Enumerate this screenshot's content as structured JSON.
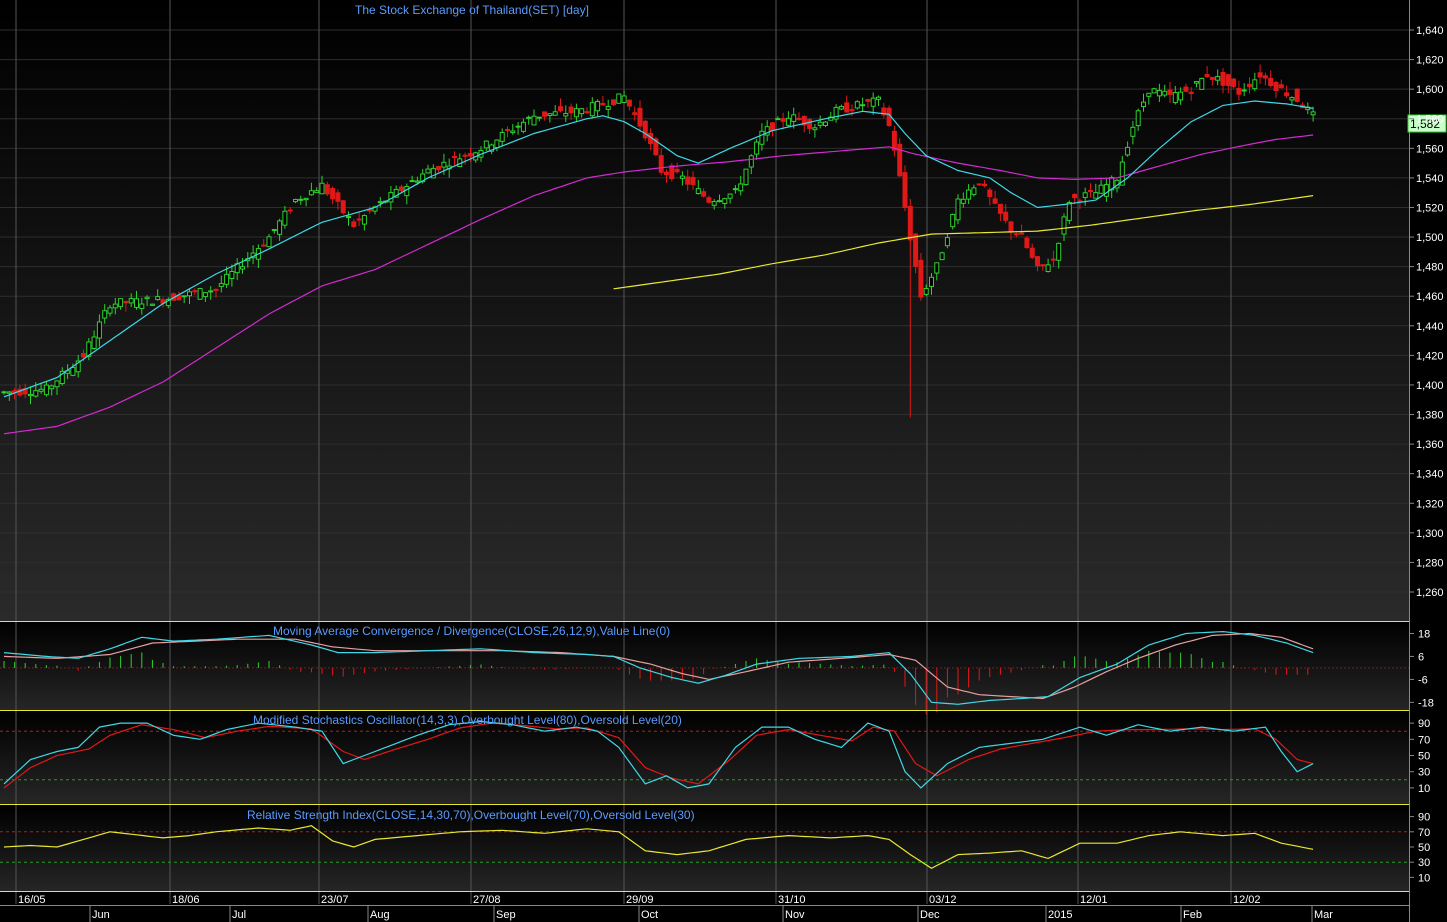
{
  "chart_data": {
    "type": "candlestick",
    "title": "The Stock Exchange of Thailand(SET) [day]",
    "last_price_label": "1,582",
    "colors": {
      "background": "#000000",
      "up_candle": "#2ed12e",
      "down_candle": "#e01818",
      "ma_short": "#3fd8e6",
      "ma_medium": "#d12bd1",
      "ma_long": "#e8e832",
      "panel_border": "#e8e832",
      "title_text": "#5a9bff",
      "axis_text": "#ffffff"
    },
    "price_panel": {
      "ylim": [
        1250,
        1650
      ],
      "ticks": [
        "1,260",
        "1,280",
        "1,300",
        "1,320",
        "1,340",
        "1,360",
        "1,380",
        "1,400",
        "1,420",
        "1,440",
        "1,460",
        "1,480",
        "1,500",
        "1,520",
        "1,540",
        "1,560",
        "1,580",
        "1,600",
        "1,620",
        "1,640"
      ],
      "close_keypoints": [
        [
          0,
          1395
        ],
        [
          8,
          1397
        ],
        [
          15,
          1420
        ],
        [
          20,
          1455
        ],
        [
          30,
          1458
        ],
        [
          40,
          1465
        ],
        [
          50,
          1500
        ],
        [
          55,
          1525
        ],
        [
          60,
          1535
        ],
        [
          66,
          1508
        ],
        [
          70,
          1520
        ],
        [
          80,
          1545
        ],
        [
          90,
          1560
        ],
        [
          100,
          1582
        ],
        [
          108,
          1585
        ],
        [
          113,
          1590
        ],
        [
          117,
          1595
        ],
        [
          121,
          1570
        ],
        [
          124,
          1545
        ],
        [
          128,
          1540
        ],
        [
          133,
          1525
        ],
        [
          138,
          1530
        ],
        [
          143,
          1570
        ],
        [
          148,
          1582
        ],
        [
          153,
          1575
        ],
        [
          157,
          1585
        ],
        [
          162,
          1590
        ],
        [
          165,
          1592
        ],
        [
          167,
          1575
        ],
        [
          168,
          1560
        ],
        [
          170,
          1520
        ],
        [
          173,
          1460
        ],
        [
          176,
          1480
        ],
        [
          180,
          1525
        ],
        [
          184,
          1538
        ],
        [
          187,
          1520
        ],
        [
          190,
          1505
        ],
        [
          192,
          1500
        ],
        [
          195,
          1478
        ],
        [
          198,
          1485
        ],
        [
          201,
          1525
        ],
        [
          206,
          1530
        ],
        [
          210,
          1540
        ],
        [
          213,
          1575
        ],
        [
          216,
          1600
        ],
        [
          220,
          1595
        ],
        [
          224,
          1600
        ],
        [
          227,
          1610
        ],
        [
          230,
          1605
        ],
        [
          233,
          1598
        ],
        [
          237,
          1610
        ],
        [
          240,
          1602
        ],
        [
          244,
          1593
        ],
        [
          247,
          1582
        ]
      ],
      "ma_short_keypoints": [
        [
          0,
          1392
        ],
        [
          10,
          1405
        ],
        [
          20,
          1430
        ],
        [
          30,
          1455
        ],
        [
          40,
          1475
        ],
        [
          50,
          1492
        ],
        [
          60,
          1510
        ],
        [
          65,
          1515
        ],
        [
          70,
          1520
        ],
        [
          80,
          1540
        ],
        [
          90,
          1556
        ],
        [
          100,
          1570
        ],
        [
          110,
          1580
        ],
        [
          113,
          1582
        ],
        [
          117,
          1578
        ],
        [
          121,
          1570
        ],
        [
          127,
          1555
        ],
        [
          131,
          1550
        ],
        [
          137,
          1560
        ],
        [
          145,
          1572
        ],
        [
          155,
          1580
        ],
        [
          162,
          1585
        ],
        [
          167,
          1583
        ],
        [
          170,
          1570
        ],
        [
          174,
          1555
        ],
        [
          180,
          1545
        ],
        [
          186,
          1540
        ],
        [
          190,
          1530
        ],
        [
          195,
          1520
        ],
        [
          200,
          1522
        ],
        [
          206,
          1525
        ],
        [
          212,
          1540
        ],
        [
          218,
          1560
        ],
        [
          224,
          1578
        ],
        [
          230,
          1589
        ],
        [
          236,
          1592
        ],
        [
          242,
          1590
        ],
        [
          247,
          1587
        ]
      ],
      "ma_medium_keypoints": [
        [
          0,
          1367
        ],
        [
          10,
          1372
        ],
        [
          20,
          1385
        ],
        [
          30,
          1402
        ],
        [
          40,
          1425
        ],
        [
          50,
          1448
        ],
        [
          60,
          1467
        ],
        [
          70,
          1478
        ],
        [
          80,
          1495
        ],
        [
          90,
          1512
        ],
        [
          100,
          1528
        ],
        [
          110,
          1540
        ],
        [
          117,
          1544
        ],
        [
          127,
          1548
        ],
        [
          137,
          1551
        ],
        [
          147,
          1555
        ],
        [
          157,
          1558
        ],
        [
          167,
          1561
        ],
        [
          172,
          1556
        ],
        [
          180,
          1550
        ],
        [
          188,
          1545
        ],
        [
          195,
          1540
        ],
        [
          202,
          1539
        ],
        [
          210,
          1540
        ],
        [
          218,
          1548
        ],
        [
          226,
          1556
        ],
        [
          234,
          1562
        ],
        [
          240,
          1566
        ],
        [
          247,
          1569
        ]
      ],
      "ma_long_keypoints": [
        [
          115,
          1465
        ],
        [
          125,
          1470
        ],
        [
          135,
          1475
        ],
        [
          145,
          1482
        ],
        [
          155,
          1488
        ],
        [
          165,
          1496
        ],
        [
          175,
          1502
        ],
        [
          185,
          1503
        ],
        [
          195,
          1504
        ],
        [
          205,
          1508
        ],
        [
          215,
          1513
        ],
        [
          225,
          1518
        ],
        [
          235,
          1522
        ],
        [
          247,
          1528
        ]
      ]
    },
    "macd_panel": {
      "title": "Moving Average Convergence / Divergence(CLOSE,26,12,9),Value Line(0)",
      "ylim": [
        -22,
        24
      ],
      "ticks": [
        "18",
        "6",
        "-6",
        "-18"
      ],
      "macd_keypoints": [
        [
          0,
          8
        ],
        [
          8,
          6
        ],
        [
          14,
          5
        ],
        [
          20,
          10
        ],
        [
          26,
          16
        ],
        [
          32,
          14
        ],
        [
          40,
          15
        ],
        [
          50,
          17
        ],
        [
          58,
          12
        ],
        [
          63,
          8
        ],
        [
          70,
          8
        ],
        [
          80,
          9
        ],
        [
          90,
          10
        ],
        [
          100,
          8
        ],
        [
          110,
          7
        ],
        [
          115,
          6
        ],
        [
          120,
          0
        ],
        [
          126,
          -5
        ],
        [
          131,
          -8
        ],
        [
          136,
          -4
        ],
        [
          142,
          2
        ],
        [
          150,
          5
        ],
        [
          160,
          6
        ],
        [
          167,
          8
        ],
        [
          171,
          -3
        ],
        [
          175,
          -18
        ],
        [
          180,
          -19
        ],
        [
          186,
          -17
        ],
        [
          192,
          -16
        ],
        [
          197,
          -15
        ],
        [
          203,
          -5
        ],
        [
          210,
          2
        ],
        [
          216,
          12
        ],
        [
          223,
          18
        ],
        [
          230,
          19
        ],
        [
          236,
          17
        ],
        [
          242,
          13
        ],
        [
          247,
          8
        ]
      ],
      "signal_keypoints": [
        [
          0,
          6
        ],
        [
          10,
          5
        ],
        [
          20,
          7
        ],
        [
          28,
          13
        ],
        [
          36,
          14
        ],
        [
          44,
          15
        ],
        [
          55,
          15
        ],
        [
          62,
          11
        ],
        [
          70,
          9
        ],
        [
          82,
          9
        ],
        [
          94,
          9
        ],
        [
          105,
          8
        ],
        [
          115,
          6
        ],
        [
          122,
          2
        ],
        [
          128,
          -3
        ],
        [
          133,
          -6
        ],
        [
          140,
          -2
        ],
        [
          148,
          3
        ],
        [
          158,
          5
        ],
        [
          167,
          7
        ],
        [
          172,
          4
        ],
        [
          178,
          -10
        ],
        [
          184,
          -14
        ],
        [
          190,
          -15
        ],
        [
          196,
          -16
        ],
        [
          202,
          -10
        ],
        [
          208,
          -2
        ],
        [
          214,
          5
        ],
        [
          221,
          12
        ],
        [
          228,
          17
        ],
        [
          235,
          18
        ],
        [
          241,
          16
        ],
        [
          247,
          10
        ]
      ]
    },
    "stochastic_panel": {
      "title": "Modified Stochastics Oscillator(14,3,3),Overbought Level(80),Oversold Level(20)",
      "ylim": [
        0,
        100
      ],
      "ticks": [
        "90",
        "70",
        "50",
        "30",
        "10"
      ],
      "overbought": 80,
      "oversold": 20,
      "k_keypoints": [
        [
          0,
          15
        ],
        [
          5,
          45
        ],
        [
          10,
          55
        ],
        [
          14,
          60
        ],
        [
          18,
          85
        ],
        [
          22,
          90
        ],
        [
          27,
          90
        ],
        [
          32,
          75
        ],
        [
          37,
          70
        ],
        [
          42,
          82
        ],
        [
          48,
          90
        ],
        [
          55,
          85
        ],
        [
          60,
          80
        ],
        [
          64,
          40
        ],
        [
          68,
          50
        ],
        [
          72,
          60
        ],
        [
          78,
          75
        ],
        [
          84,
          88
        ],
        [
          90,
          92
        ],
        [
          96,
          88
        ],
        [
          102,
          80
        ],
        [
          108,
          85
        ],
        [
          112,
          80
        ],
        [
          116,
          60
        ],
        [
          121,
          15
        ],
        [
          125,
          25
        ],
        [
          129,
          10
        ],
        [
          133,
          15
        ],
        [
          138,
          60
        ],
        [
          143,
          85
        ],
        [
          148,
          85
        ],
        [
          153,
          70
        ],
        [
          158,
          60
        ],
        [
          163,
          90
        ],
        [
          167,
          80
        ],
        [
          170,
          30
        ],
        [
          173,
          10
        ],
        [
          178,
          40
        ],
        [
          184,
          60
        ],
        [
          190,
          65
        ],
        [
          196,
          70
        ],
        [
          203,
          85
        ],
        [
          208,
          75
        ],
        [
          214,
          88
        ],
        [
          220,
          80
        ],
        [
          226,
          85
        ],
        [
          232,
          80
        ],
        [
          238,
          85
        ],
        [
          241,
          55
        ],
        [
          244,
          30
        ],
        [
          247,
          40
        ]
      ],
      "d_keypoints": [
        [
          0,
          10
        ],
        [
          5,
          35
        ],
        [
          10,
          50
        ],
        [
          16,
          58
        ],
        [
          20,
          75
        ],
        [
          26,
          88
        ],
        [
          32,
          82
        ],
        [
          38,
          72
        ],
        [
          44,
          80
        ],
        [
          50,
          86
        ],
        [
          58,
          83
        ],
        [
          64,
          55
        ],
        [
          68,
          45
        ],
        [
          74,
          58
        ],
        [
          80,
          70
        ],
        [
          86,
          84
        ],
        [
          92,
          90
        ],
        [
          98,
          87
        ],
        [
          104,
          83
        ],
        [
          110,
          84
        ],
        [
          116,
          72
        ],
        [
          121,
          35
        ],
        [
          126,
          22
        ],
        [
          131,
          15
        ],
        [
          137,
          45
        ],
        [
          142,
          75
        ],
        [
          148,
          82
        ],
        [
          154,
          75
        ],
        [
          160,
          68
        ],
        [
          164,
          85
        ],
        [
          168,
          80
        ],
        [
          172,
          40
        ],
        [
          176,
          25
        ],
        [
          182,
          45
        ],
        [
          188,
          58
        ],
        [
          194,
          65
        ],
        [
          200,
          72
        ],
        [
          206,
          80
        ],
        [
          212,
          82
        ],
        [
          218,
          82
        ],
        [
          224,
          83
        ],
        [
          230,
          82
        ],
        [
          236,
          83
        ],
        [
          240,
          70
        ],
        [
          244,
          45
        ],
        [
          247,
          40
        ]
      ]
    },
    "rsi_panel": {
      "title": "Relative Strength Index(CLOSE,14,30,70),Overbought Level(70),Oversold Level(30)",
      "ylim": [
        0,
        100
      ],
      "ticks": [
        "90",
        "70",
        "50",
        "30",
        "10"
      ],
      "overbought": 70,
      "oversold": 30,
      "rsi_keypoints": [
        [
          0,
          50
        ],
        [
          5,
          52
        ],
        [
          10,
          50
        ],
        [
          15,
          60
        ],
        [
          20,
          70
        ],
        [
          25,
          66
        ],
        [
          30,
          62
        ],
        [
          35,
          65
        ],
        [
          40,
          70
        ],
        [
          48,
          75
        ],
        [
          54,
          72
        ],
        [
          58,
          78
        ],
        [
          62,
          58
        ],
        [
          66,
          50
        ],
        [
          70,
          60
        ],
        [
          78,
          65
        ],
        [
          86,
          70
        ],
        [
          94,
          72
        ],
        [
          102,
          68
        ],
        [
          110,
          74
        ],
        [
          116,
          70
        ],
        [
          121,
          45
        ],
        [
          127,
          40
        ],
        [
          133,
          45
        ],
        [
          140,
          60
        ],
        [
          148,
          65
        ],
        [
          156,
          62
        ],
        [
          163,
          65
        ],
        [
          167,
          60
        ],
        [
          171,
          40
        ],
        [
          175,
          22
        ],
        [
          180,
          40
        ],
        [
          186,
          42
        ],
        [
          192,
          45
        ],
        [
          197,
          35
        ],
        [
          203,
          55
        ],
        [
          210,
          55
        ],
        [
          216,
          65
        ],
        [
          222,
          70
        ],
        [
          230,
          65
        ],
        [
          236,
          68
        ],
        [
          241,
          55
        ],
        [
          247,
          47
        ]
      ]
    },
    "x_axis_top_labels": [
      "16/05",
      "18/06",
      "23/07",
      "27/08",
      "29/09",
      "31/10",
      "03/12",
      "12/01",
      "12/02"
    ],
    "x_axis_bottom_labels": [
      "Jun",
      "Jul",
      "Aug",
      "Sep",
      "Oct",
      "Nov",
      "Dec",
      "2015",
      "Feb",
      "Mar"
    ]
  }
}
